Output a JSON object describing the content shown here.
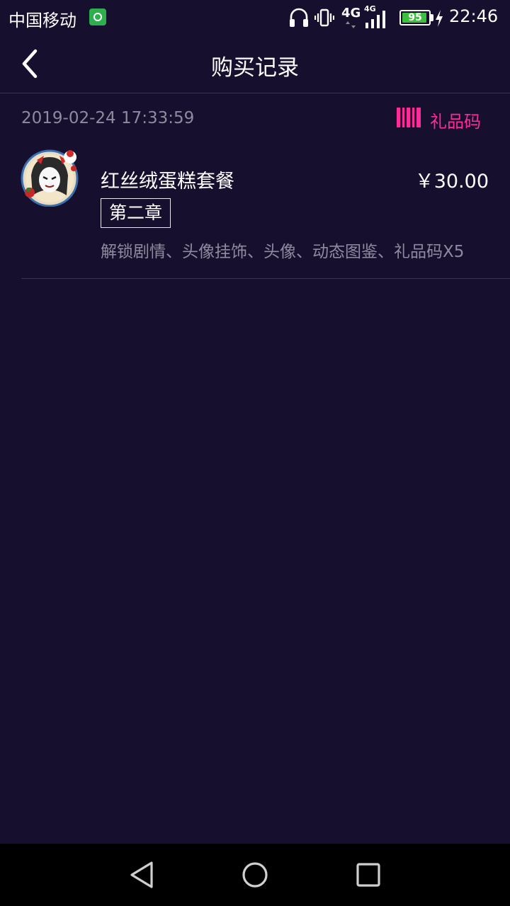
{
  "status_bar": {
    "carrier": "中国移动",
    "network_primary": "4G",
    "network_secondary": "4G",
    "battery_level": "95",
    "battery_fraction": 0.95,
    "time": "22:46",
    "icons": [
      "headphones-icon",
      "vibrate-icon",
      "signal-icon",
      "battery-icon",
      "charging-icon"
    ]
  },
  "header": {
    "title": "购买记录",
    "back_icon": "chevron-left-icon"
  },
  "records": [
    {
      "time": "2019-02-24 17:33:59",
      "giftcode_label": "礼品码",
      "name": "红丝绒蛋糕套餐",
      "price": "￥30.00",
      "chapter": "第二章",
      "description": "解锁剧情、头像挂饰、头像、动态图鉴、礼品码X5"
    }
  ],
  "colors": {
    "background": "#170f2e",
    "accent": "#ff2a9a",
    "muted_text": "#8f8a9e",
    "divider": "#3a3350"
  },
  "nav": {
    "back": "nav-back-icon",
    "home": "nav-home-icon",
    "recents": "nav-recents-icon"
  }
}
